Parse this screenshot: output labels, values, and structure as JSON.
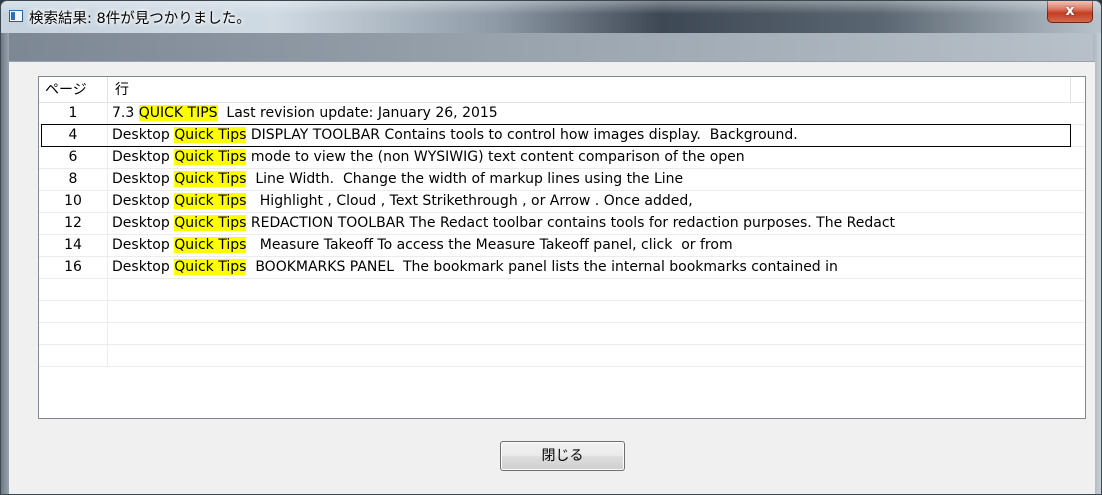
{
  "window": {
    "title": "検索結果: 8件が見つかりました。",
    "close_glyph": "x"
  },
  "list": {
    "columns": {
      "page": "ページ",
      "line": "行"
    },
    "rows": [
      {
        "page": "1",
        "before": "7.3 ",
        "highlight": "QUICK TIPS",
        "after": "  Last revision update: January 26, 2015"
      },
      {
        "page": "4",
        "before": "Desktop ",
        "highlight": "Quick Tips",
        "after": " DISPLAY TOOLBAR Contains tools to control how images display.  Background."
      },
      {
        "page": "6",
        "before": "Desktop ",
        "highlight": "Quick Tips",
        "after": " mode to view the (non WYSIWIG) text content comparison of the open"
      },
      {
        "page": "8",
        "before": "Desktop ",
        "highlight": "Quick Tips",
        "after": "  Line Width.  Change the width of markup lines using the Line"
      },
      {
        "page": "10",
        "before": "Desktop ",
        "highlight": "Quick Tips",
        "after": "   Highlight , Cloud , Text Strikethrough , or Arrow . Once added,"
      },
      {
        "page": "12",
        "before": "Desktop ",
        "highlight": "Quick Tips",
        "after": " REDACTION TOOLBAR The Redact toolbar contains tools for redaction purposes. The Redact"
      },
      {
        "page": "14",
        "before": "Desktop ",
        "highlight": "Quick Tips",
        "after": "   Measure Takeoff To access the Measure Takeoff panel, click  or from"
      },
      {
        "page": "16",
        "before": "Desktop ",
        "highlight": "Quick Tips",
        "after": "  BOOKMARKS PANEL  The bookmark panel lists the internal bookmarks contained in"
      }
    ],
    "empty_rows": 4,
    "focused_row": 1,
    "highlight_color": "#ffff00"
  },
  "footer": {
    "close_label": "閉じる"
  }
}
